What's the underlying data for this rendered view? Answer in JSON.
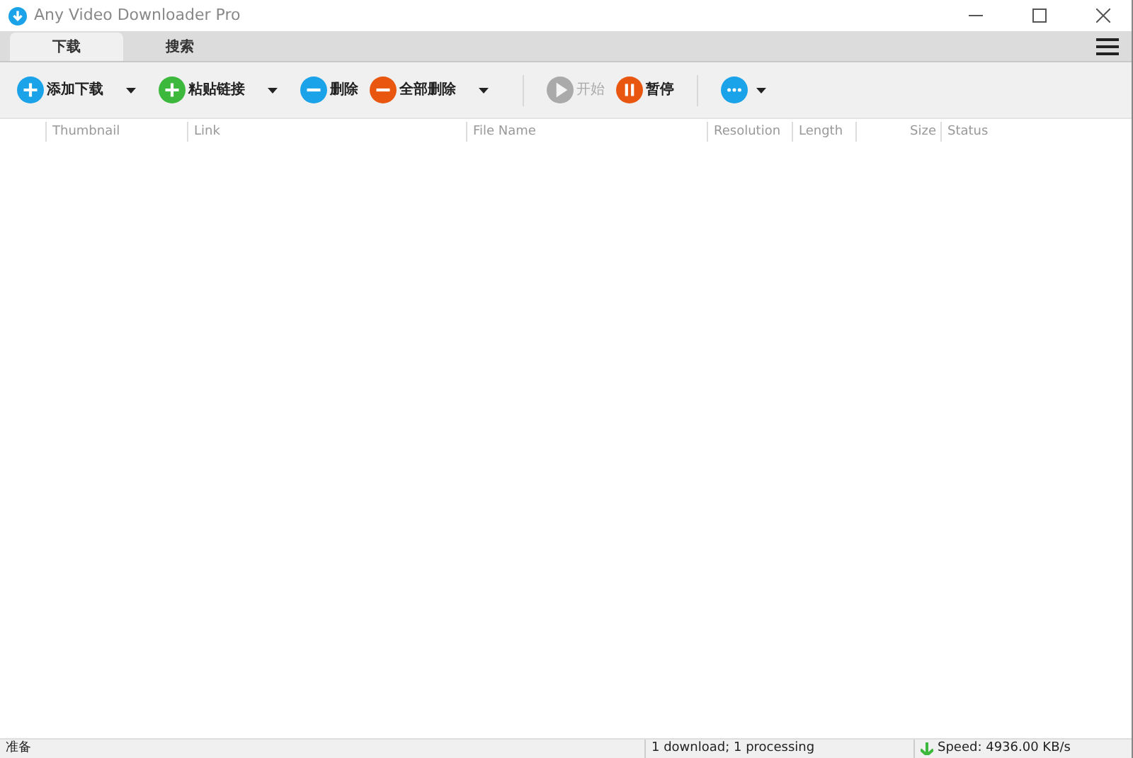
{
  "window": {
    "title": "Any Video Downloader Pro"
  },
  "tabs": [
    {
      "label": "下载",
      "selected": true
    },
    {
      "label": "搜索",
      "selected": false
    }
  ],
  "toolbar": [
    {
      "kind": "plus",
      "color": "#1aa3e8",
      "label": "添加下载",
      "dropdown": true,
      "disabled": false
    },
    {
      "kind": "plus",
      "color": "#3cb83c",
      "label": "粘贴链接",
      "dropdown": true,
      "disabled": false
    },
    {
      "kind": "minus",
      "color": "#1aa3e8",
      "label": "删除",
      "dropdown": false,
      "disabled": false
    },
    {
      "kind": "minus",
      "color": "#e8560f",
      "label": "全部删除",
      "dropdown": true,
      "disabled": false
    },
    {
      "kind": "separator"
    },
    {
      "kind": "play",
      "color": "#aaaaaa",
      "label": "开始",
      "dropdown": false,
      "disabled": true
    },
    {
      "kind": "pause",
      "color": "#e8560f",
      "label": "暂停",
      "dropdown": false,
      "disabled": false
    },
    {
      "kind": "separator"
    },
    {
      "kind": "more",
      "color": "#1aa3e8",
      "dropdown": true,
      "disabled": false
    }
  ],
  "table": {
    "columns": [
      "Thumbnail",
      "Link",
      "File Name",
      "Resolution",
      "Length",
      "Size",
      "Status"
    ]
  },
  "status_bar": [
    "准备",
    "1 download; 1 processing",
    "Speed: 4936.00 KB/s"
  ]
}
